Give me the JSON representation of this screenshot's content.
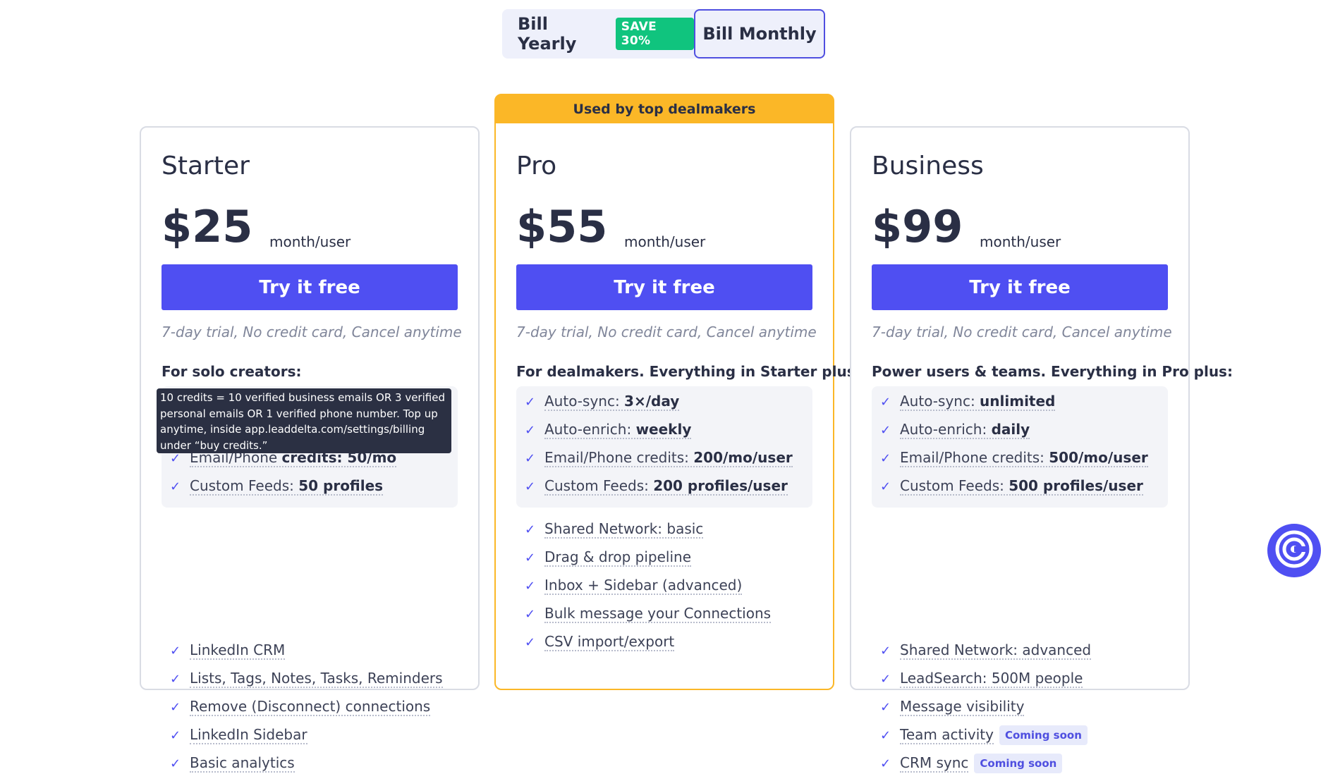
{
  "billing_toggle": {
    "yearly_label": "Bill Yearly",
    "save_badge": "SAVE 30%",
    "monthly_label": "Bill Monthly"
  },
  "plans": [
    {
      "name": "Starter",
      "price": "$25",
      "period": "month/user",
      "cta": "Try it free",
      "trial": "7-day trial, No credit card, Cancel anytime",
      "audience": "For solo creators:",
      "highlights": [
        {
          "label": "Email/Phone ",
          "value": "credits: 50/mo"
        },
        {
          "label": "Custom Feeds: ",
          "value": "50 profiles"
        }
      ],
      "features": [
        {
          "label": "LinkedIn CRM"
        },
        {
          "label": "Lists, Tags, Notes, Tasks, Reminders"
        },
        {
          "label": "Remove (Disconnect) connections"
        },
        {
          "label": "LinkedIn Sidebar"
        },
        {
          "label": "Basic analytics"
        }
      ]
    },
    {
      "ribbon": "Used by top dealmakers",
      "name": "Pro",
      "price": "$55",
      "period": "month/user",
      "cta": "Try it free",
      "trial": "7-day trial, No credit card, Cancel anytime",
      "audience": "For dealmakers. Everything in Starter plus:",
      "highlights": [
        {
          "label": "Auto-sync: ",
          "value": "3×/day"
        },
        {
          "label": "Auto-enrich: ",
          "value": "weekly"
        },
        {
          "label": "Email/Phone credits: ",
          "value": "200/mo/user"
        },
        {
          "label": "Custom Feeds: ",
          "value": "200 profiles/user"
        }
      ],
      "features": [
        {
          "label": "Shared Network: basic"
        },
        {
          "label": "Drag & drop pipeline"
        },
        {
          "label": "Inbox + Sidebar (advanced)"
        },
        {
          "label": "Bulk message your Connections"
        },
        {
          "label": "CSV import/export"
        }
      ]
    },
    {
      "name": "Business",
      "price": "$99",
      "period": "month/user",
      "cta": "Try it free",
      "trial": "7-day trial, No credit card, Cancel anytime",
      "audience": "Power users & teams. Everything in Pro plus:",
      "highlights": [
        {
          "label": "Auto-sync: ",
          "value": "unlimited"
        },
        {
          "label": "Auto-enrich: ",
          "value": "daily"
        },
        {
          "label": "Email/Phone credits: ",
          "value": "500/mo/user"
        },
        {
          "label": "Custom Feeds: ",
          "value": "500 profiles/user"
        }
      ],
      "features": [
        {
          "label": "Shared Network: advanced"
        },
        {
          "label": "LeadSearch: 500M people"
        },
        {
          "label": "Message visibility"
        },
        {
          "label": "Team activity",
          "badge": "Coming soon"
        },
        {
          "label": "CRM sync",
          "badge": "Coming soon"
        }
      ]
    }
  ],
  "tooltip": "10 credits = 10 verified business emails OR 3 verified personal emails OR 1 verified phone number. Top up anytime, inside app.leaddelta.com/settings/billing under “buy credits.”",
  "chat_widget": {
    "icon": "chat-spiral-icon"
  },
  "colors": {
    "accent": "#4f4ff2",
    "ribbon": "#fbb727",
    "save_badge": "#10c47e"
  }
}
